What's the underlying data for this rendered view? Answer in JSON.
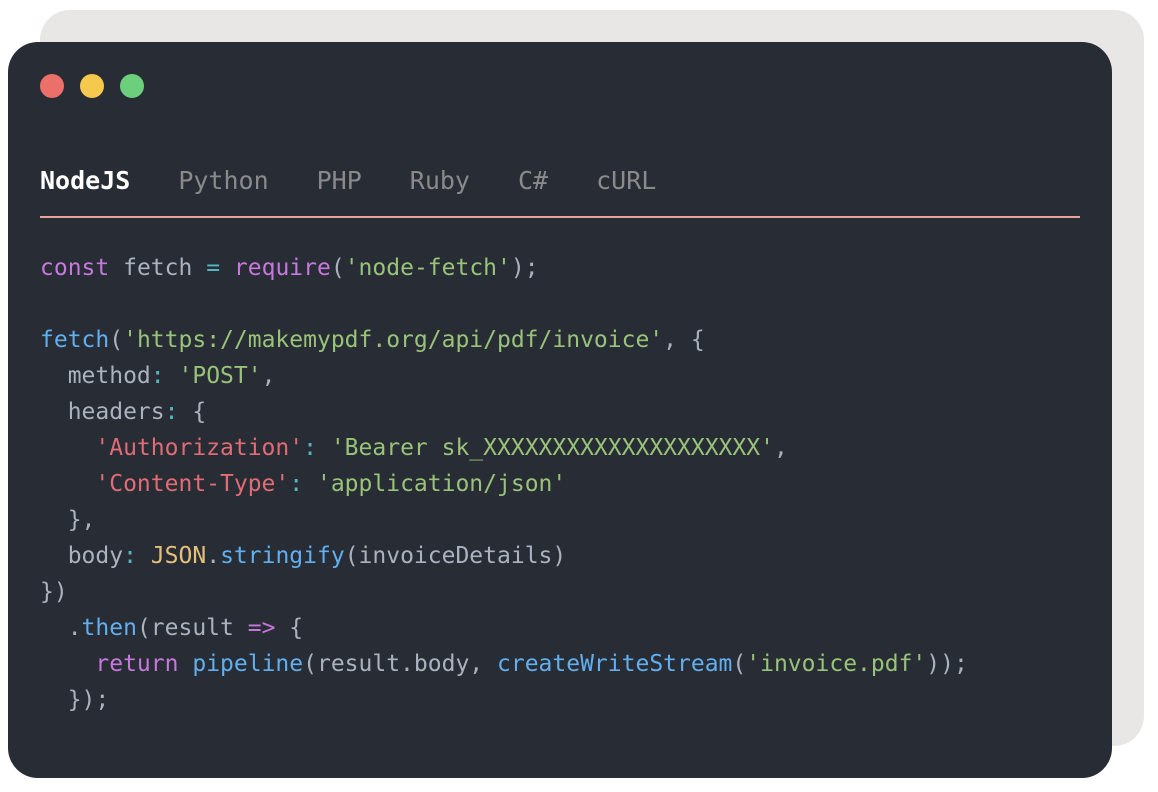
{
  "window": {
    "traffic_lights": [
      {
        "name": "close",
        "color": "#ec6f6a"
      },
      {
        "name": "minimize",
        "color": "#f5c94e"
      },
      {
        "name": "maximize",
        "color": "#6ccf7c"
      }
    ]
  },
  "tabs": [
    {
      "label": "NodeJS",
      "active": true
    },
    {
      "label": "Python",
      "active": false
    },
    {
      "label": "PHP",
      "active": false
    },
    {
      "label": "Ruby",
      "active": false
    },
    {
      "label": "C#",
      "active": false
    },
    {
      "label": "cURL",
      "active": false
    }
  ],
  "colors": {
    "background": "#282c34",
    "tab_underline": "#e7a39d",
    "keyword": "#c678dd",
    "function": "#61afef",
    "string": "#98c379",
    "key": "#e06c75",
    "class": "#e5c07b",
    "operator": "#56b6c2",
    "plain": "#abb2bf"
  },
  "code_lines": [
    [
      [
        "kw",
        "const"
      ],
      [
        "plain",
        " fetch "
      ],
      [
        "op",
        "="
      ],
      [
        "plain",
        " "
      ],
      [
        "kw",
        "require"
      ],
      [
        "plain",
        "("
      ],
      [
        "str",
        "'node-fetch'"
      ],
      [
        "plain",
        ");"
      ]
    ],
    [],
    [
      [
        "fn",
        "fetch"
      ],
      [
        "plain",
        "("
      ],
      [
        "str",
        "'https://makemypdf.org/api/pdf/invoice'"
      ],
      [
        "plain",
        ", {"
      ]
    ],
    [
      [
        "plain",
        "  method"
      ],
      [
        "op",
        ":"
      ],
      [
        "plain",
        " "
      ],
      [
        "str",
        "'POST'"
      ],
      [
        "plain",
        ","
      ]
    ],
    [
      [
        "plain",
        "  headers"
      ],
      [
        "op",
        ":"
      ],
      [
        "plain",
        " {"
      ]
    ],
    [
      [
        "plain",
        "    "
      ],
      [
        "key",
        "'Authorization'"
      ],
      [
        "op",
        ":"
      ],
      [
        "plain",
        " "
      ],
      [
        "str",
        "'Bearer sk_XXXXXXXXXXXXXXXXXXXX'"
      ],
      [
        "plain",
        ","
      ]
    ],
    [
      [
        "plain",
        "    "
      ],
      [
        "key",
        "'Content-Type'"
      ],
      [
        "op",
        ":"
      ],
      [
        "plain",
        " "
      ],
      [
        "str",
        "'application/json'"
      ]
    ],
    [
      [
        "plain",
        "  },"
      ]
    ],
    [
      [
        "plain",
        "  body"
      ],
      [
        "op",
        ":"
      ],
      [
        "plain",
        " "
      ],
      [
        "cls",
        "JSON"
      ],
      [
        "plain",
        "."
      ],
      [
        "fn",
        "stringify"
      ],
      [
        "plain",
        "(invoiceDetails)"
      ]
    ],
    [
      [
        "plain",
        "})"
      ]
    ],
    [
      [
        "plain",
        "  ."
      ],
      [
        "fn",
        "then"
      ],
      [
        "plain",
        "(result "
      ],
      [
        "kw",
        "=>"
      ],
      [
        "plain",
        " {"
      ]
    ],
    [
      [
        "plain",
        "    "
      ],
      [
        "kw",
        "return"
      ],
      [
        "plain",
        " "
      ],
      [
        "fn",
        "pipeline"
      ],
      [
        "plain",
        "(result.body, "
      ],
      [
        "fn",
        "createWriteStream"
      ],
      [
        "plain",
        "("
      ],
      [
        "str",
        "'invoice.pdf'"
      ],
      [
        "plain",
        "));"
      ]
    ],
    [
      [
        "plain",
        "  });"
      ]
    ]
  ]
}
